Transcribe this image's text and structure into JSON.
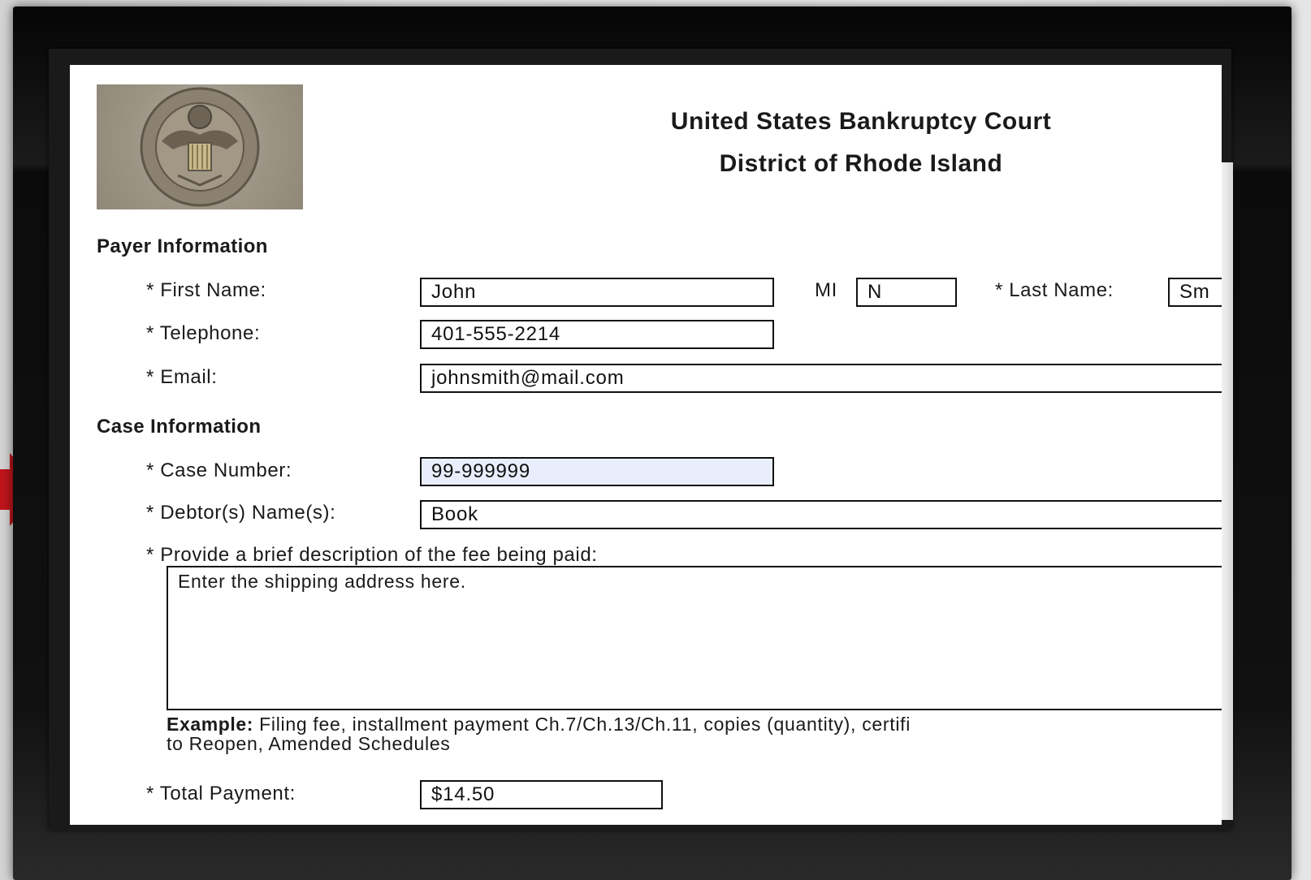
{
  "court": {
    "title": "United States Bankruptcy Court",
    "district": "District of Rhode Island",
    "seal_icon": "court-seal-icon"
  },
  "payer": {
    "section_title": "Payer Information",
    "first_name_label": "* First Name:",
    "first_name_value": "John",
    "mi_label": "MI",
    "mi_value": "N",
    "last_name_label": "* Last Name:",
    "last_name_value": "Sm",
    "telephone_label": "* Telephone:",
    "telephone_value": "401-555-2214",
    "email_label": "* Email:",
    "email_value": "johnsmith@mail.com"
  },
  "case": {
    "section_title": "Case Information",
    "case_number_label": "* Case Number:",
    "case_number_value": "99-999999",
    "debtor_label": "* Debtor(s) Name(s):",
    "debtor_value": "Book",
    "description_label": "* Provide a brief description of the fee being paid:",
    "description_value": "Enter the shipping address here.",
    "example_label": "Example:",
    "example_text_line1": "Filing fee, installment payment Ch.7/Ch.13/Ch.11, copies (quantity), certifi",
    "example_text_line2": "to Reopen, Amended Schedules",
    "total_label": "* Total Payment:",
    "total_value": "$14.50"
  },
  "colors": {
    "arrow": "#c0151b",
    "highlight_field": "#e8eefb",
    "frame": "#0b0b0b"
  }
}
